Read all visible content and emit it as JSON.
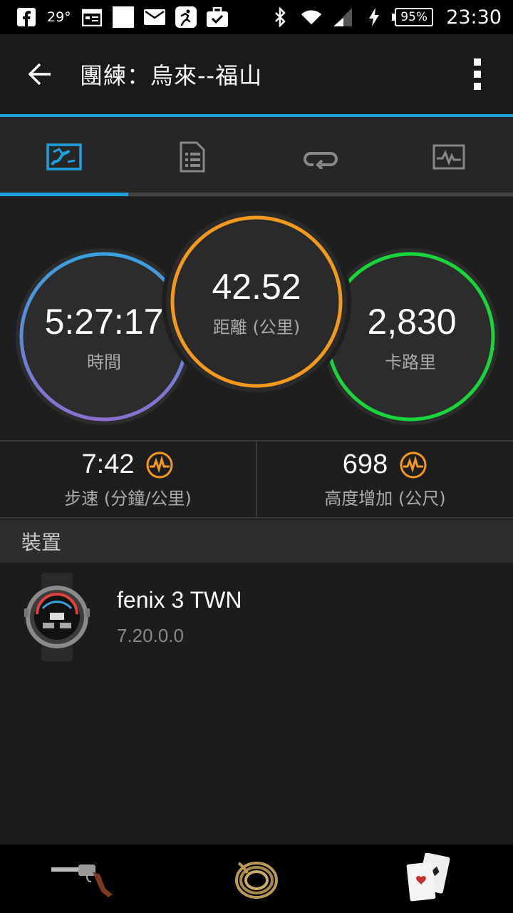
{
  "status_bar": {
    "temperature": "29°",
    "battery": "95%",
    "time": "23:30",
    "icons": [
      "facebook-icon",
      "calendar-icon",
      "blank-icon",
      "mail-icon",
      "runner-icon",
      "briefcase-icon",
      "bluetooth-icon",
      "wifi-icon",
      "signal-icon",
      "charging-icon"
    ]
  },
  "header": {
    "title": "團練：烏來--福山",
    "back_icon": "arrow-left-icon",
    "menu_icon": "more-vertical-icon"
  },
  "tabs": [
    {
      "icon": "map-icon",
      "active": true
    },
    {
      "icon": "details-list-icon",
      "active": false
    },
    {
      "icon": "laps-icon",
      "active": false
    },
    {
      "icon": "chart-icon",
      "active": false
    }
  ],
  "circles": {
    "time": {
      "value": "5:27:17",
      "label": "時間"
    },
    "distance": {
      "value": "42.52",
      "label": "距離 (公里)"
    },
    "calories": {
      "value": "2,830",
      "label": "卡路里"
    }
  },
  "stats": {
    "pace": {
      "value": "7:42",
      "label": "步速 (分鐘/公里)"
    },
    "elevation": {
      "value": "698",
      "label": "高度增加 (公尺)"
    }
  },
  "devices": {
    "section_title": "裝置",
    "name": "fenix 3 TWN",
    "version": "7.20.0.0"
  },
  "colors": {
    "accent": "#1ea0dc",
    "orange": "#f39a1e",
    "green": "#19d43a",
    "blue": "#3aa0e0",
    "purple": "#8a6fd0"
  }
}
